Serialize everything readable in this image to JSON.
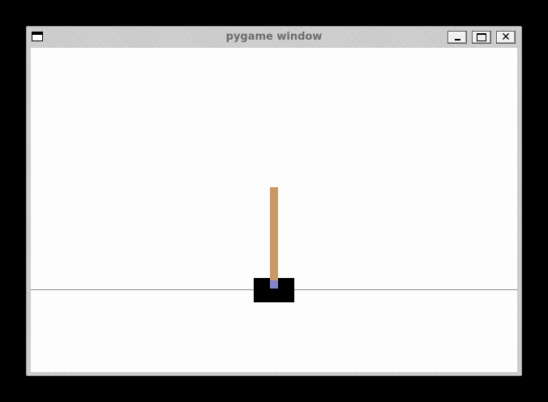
{
  "window": {
    "title": "pygame window",
    "buttons": {
      "minimize_icon": "minimize-icon",
      "maximize_icon": "maximize-icon",
      "close_icon": "close-icon",
      "close_glyph": "✕"
    }
  },
  "scene": {
    "background_color": "#fdfdfd",
    "track_color": "#8c8c8c",
    "cart_color": "#000000",
    "pole_color": "#ca9865",
    "axle_color": "#8185ca"
  }
}
